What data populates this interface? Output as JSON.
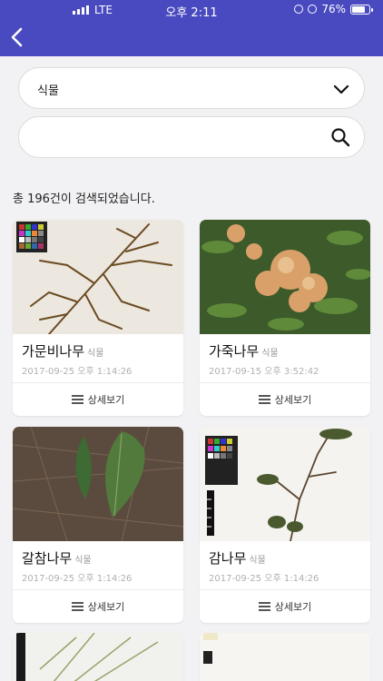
{
  "status_bar": {
    "carrier": "LTE",
    "time": "오후 2:11",
    "battery": "76%"
  },
  "header": {
    "back_icon": "chevron-left-icon",
    "color": "#4a4ac0"
  },
  "filter": {
    "selected": "식물",
    "icon": "chevron-down-icon"
  },
  "search": {
    "value": "",
    "placeholder": "",
    "icon": "search-icon"
  },
  "result_count": "총 196건이 검색되었습니다.",
  "cards": [
    {
      "name": "가문비나무",
      "type": "식물",
      "date": "2017-09-25 오후 1:14:26",
      "detail_label": "상세보기"
    },
    {
      "name": "가죽나무",
      "type": "식물",
      "date": "2017-09-15 오후 3:52:42",
      "detail_label": "상세보기"
    },
    {
      "name": "갈참나무",
      "type": "식물",
      "date": "2017-09-25 오후 1:14:26",
      "detail_label": "상세보기"
    },
    {
      "name": "감나무",
      "type": "식물",
      "date": "2017-09-25 오후 1:14:26",
      "detail_label": "상세보기"
    }
  ]
}
